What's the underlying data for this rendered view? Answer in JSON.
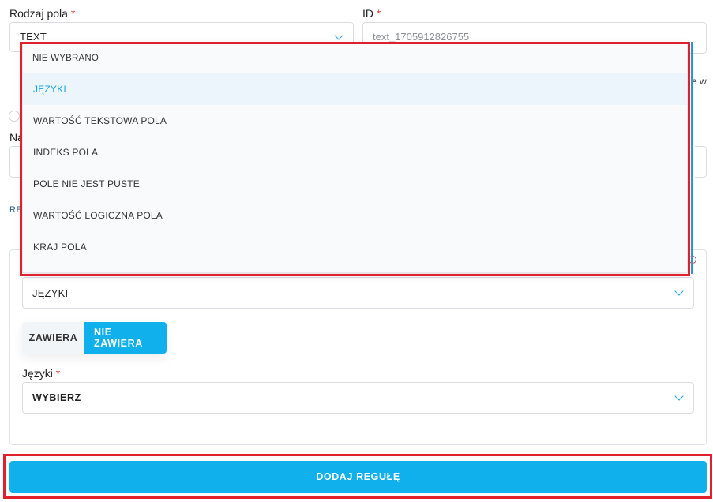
{
  "form": {
    "field_type_label": "Rodzaj pola",
    "field_type_value": "TEXT",
    "id_label": "ID",
    "id_value": "text_1705912826755",
    "required_mark": "*",
    "partial_name_label": "Na",
    "partial_re_link": "RE",
    "partial_side_text": "e w"
  },
  "dropdown": {
    "items": [
      "NIE WYBRANO",
      "JĘZYKI",
      "WARTOŚĆ TEKSTOWA POLA",
      "INDEKS POLA",
      "POLE NIE JEST PUSTE",
      "WARTOŚĆ LOGICZNA POLA",
      "KRAJ POLA"
    ],
    "active_index": 1
  },
  "rule": {
    "condition_value": "JĘZYKI",
    "toggle": {
      "contains": "ZAWIERA",
      "not_contains": "NIE ZAWIERA",
      "selected": "not_contains"
    },
    "languages_label": "Języki",
    "languages_value": "WYBIERZ"
  },
  "actions": {
    "add_rule": "DODAJ REGUŁĘ"
  },
  "colors": {
    "accent": "#0fb0ec",
    "highlight": "#e0212b",
    "required": "#e23a3a"
  }
}
